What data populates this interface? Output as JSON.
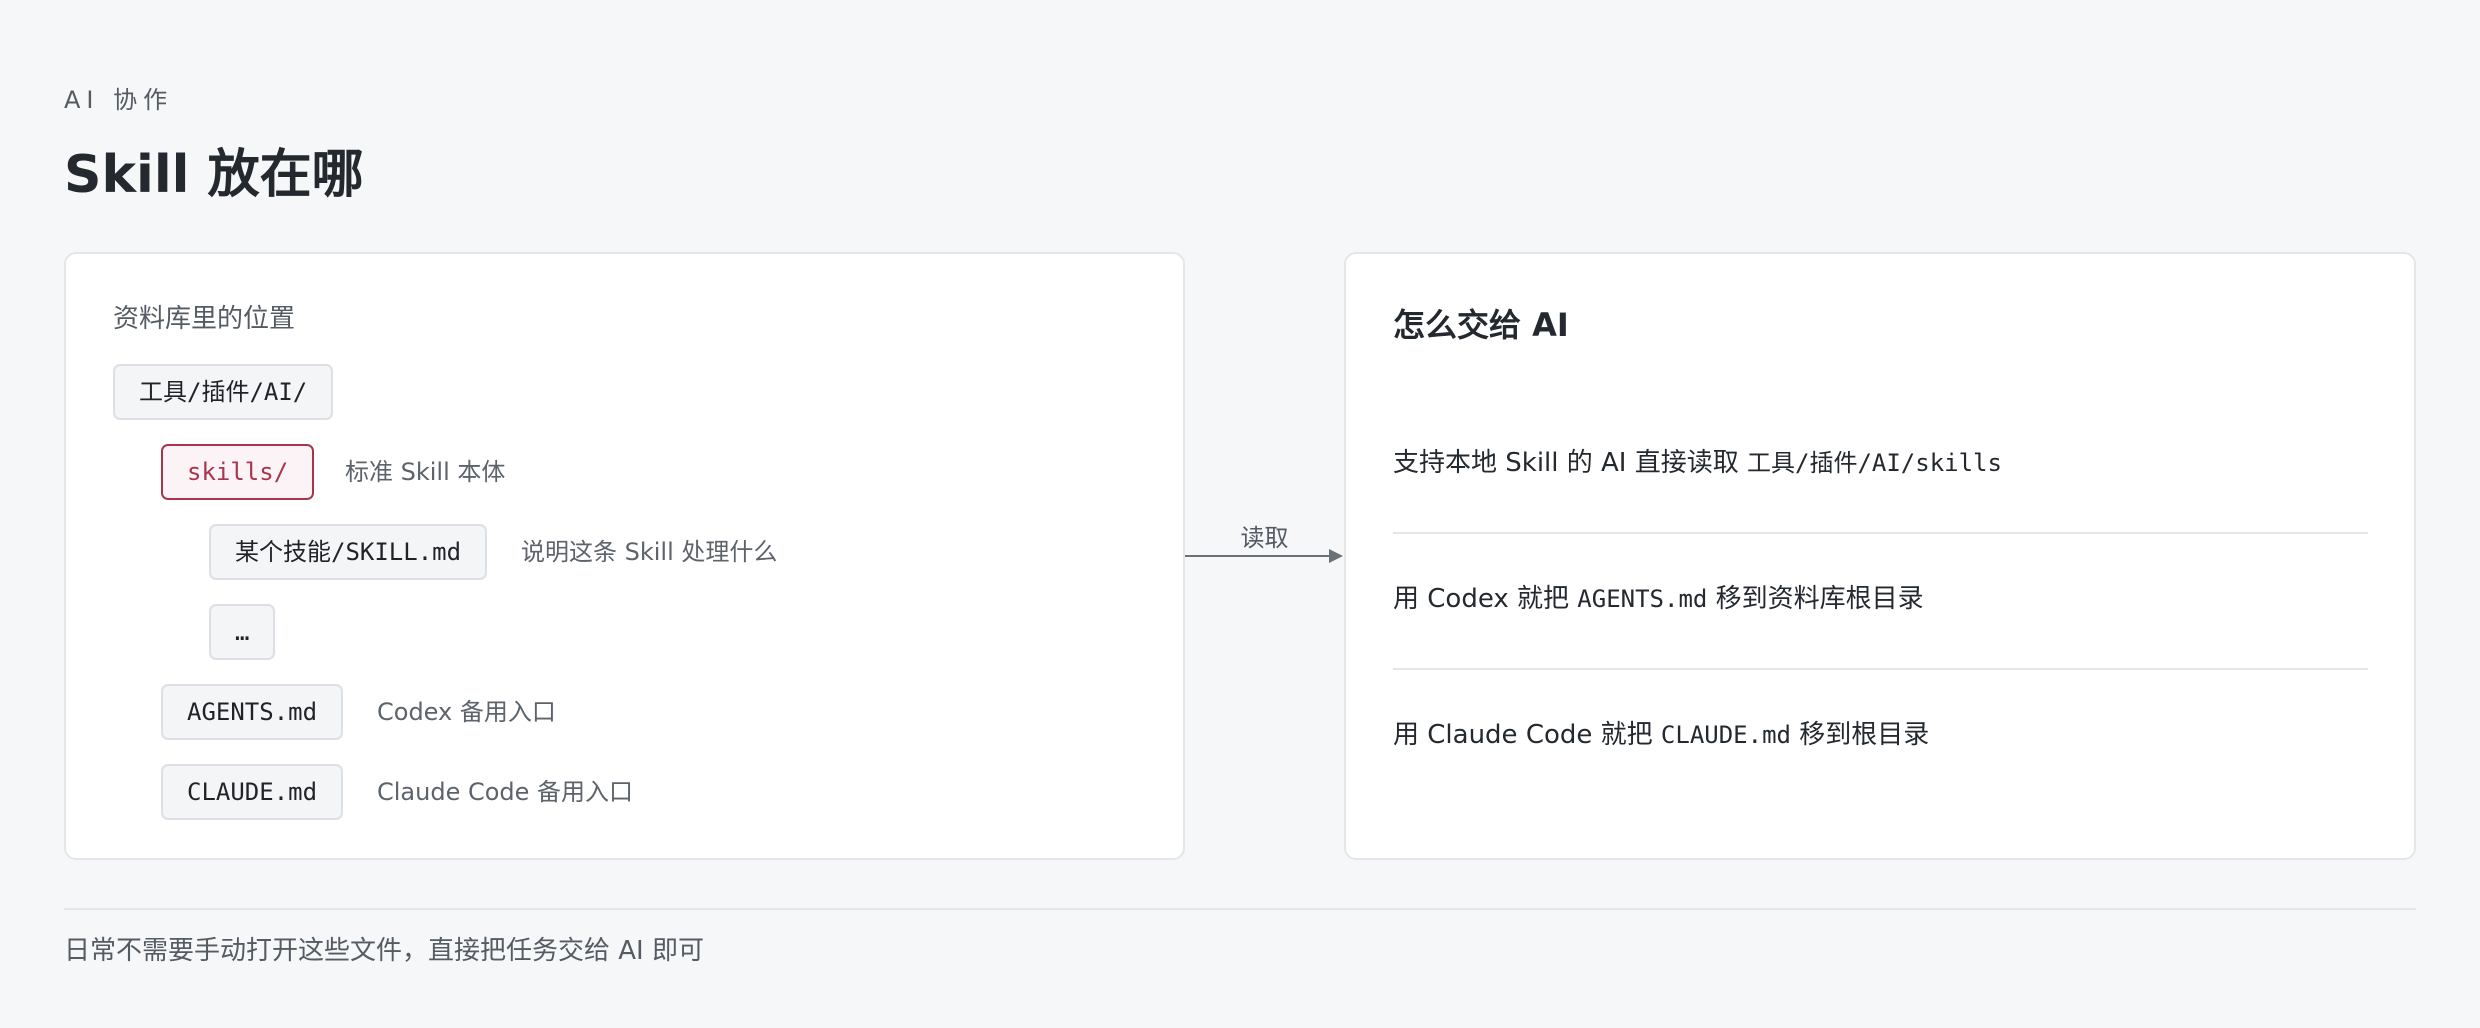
{
  "header": {
    "eyebrow": "AI 协作",
    "title": "Skill 放在哪"
  },
  "location_panel": {
    "label": "资料库里的位置",
    "root": "工具/插件/AI/",
    "items": [
      {
        "path": "skills/",
        "note": "标准 Skill 本体",
        "highlight": true
      },
      {
        "path": "某个技能/SKILL.md",
        "note": "说明这条 Skill 处理什么"
      },
      {
        "path": "…",
        "note": ""
      },
      {
        "path": "AGENTS.md",
        "note": "Codex 备用入口"
      },
      {
        "path": "CLAUDE.md",
        "note": "Claude Code 备用入口"
      }
    ]
  },
  "connector": {
    "label": "读取"
  },
  "handoff_panel": {
    "title": "怎么交给 AI",
    "steps": [
      {
        "text": "支持本地 Skill 的 AI 直接读取 ",
        "code": "工具/插件/AI/skills",
        "suffix": ""
      },
      {
        "text": "用 Codex 就把 ",
        "code": "AGENTS.md",
        "suffix": " 移到资料库根目录"
      },
      {
        "text": "用 Claude Code 就把 ",
        "code": "CLAUDE.md",
        "suffix": " 移到根目录"
      }
    ]
  },
  "footer": {
    "note": "日常不需要手动打开这些文件，直接把任务交给 AI 即可"
  },
  "colors": {
    "accent": "#a8354d",
    "background": "#f6f7f9",
    "panel": "#ffffff",
    "border": "#e4e6ea"
  }
}
